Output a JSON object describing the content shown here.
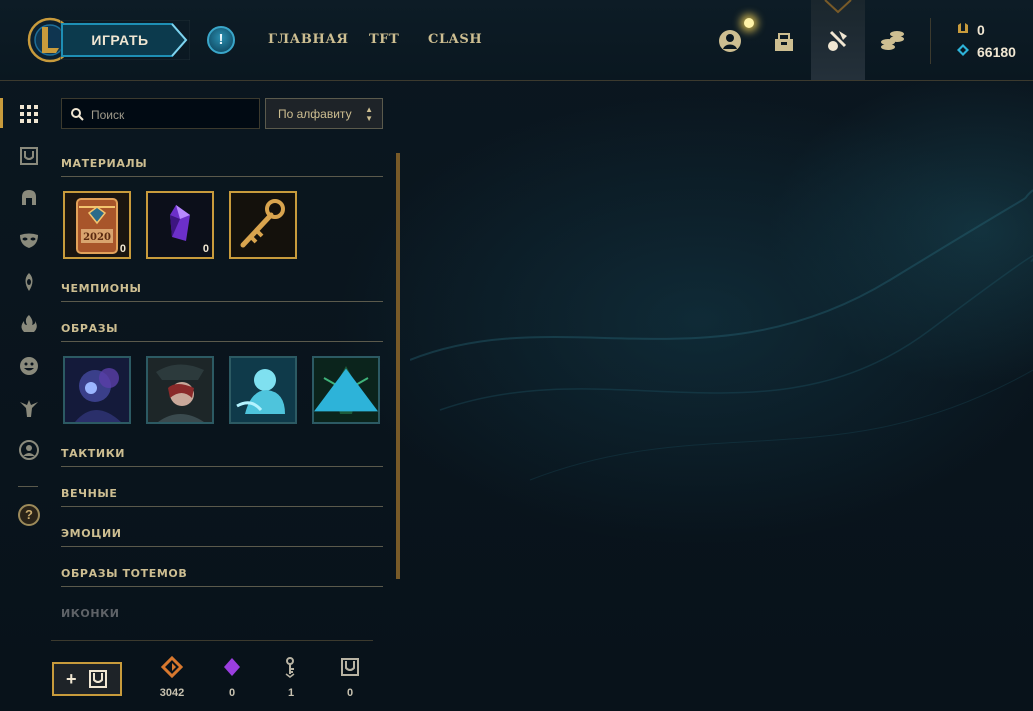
{
  "header": {
    "play_label": "ИГРАТЬ",
    "alert_glyph": "!",
    "nav": [
      "ГЛАВНАЯ",
      "TFT",
      "CLASH"
    ],
    "icons": [
      "profile-icon",
      "collection-icon",
      "loot-icon",
      "store-icon"
    ],
    "currency": {
      "rp": "0",
      "blue_essence": "66180"
    }
  },
  "rail": {
    "icons": [
      "grid-icon",
      "chest-icon",
      "helmet-icon",
      "mask-icon",
      "ward-icon",
      "flame-icon",
      "emote-icon",
      "totem-icon",
      "icon-icon"
    ],
    "help_glyph": "?"
  },
  "search": {
    "placeholder": "Поиск",
    "value": ""
  },
  "sort": {
    "label": "По алфавиту"
  },
  "categories": {
    "materials": "МАТЕРИАЛЫ",
    "champions": "ЧЕМПИОНЫ",
    "skins": "ОБРАЗЫ",
    "tactics": "ТАКТИКИ",
    "eternals": "ВЕЧНЫЕ",
    "emotes": "ЭМОЦИИ",
    "ward_skins": "ОБРАЗЫ ТОТЕМОВ",
    "icons": "ИКОНКИ"
  },
  "materials": [
    {
      "name": "2020-capsule",
      "year": "2020",
      "count": "0"
    },
    {
      "name": "gem",
      "count": "0"
    },
    {
      "name": "key-fragment",
      "count": ""
    }
  ],
  "skins": [
    "skin-shard-1",
    "skin-shard-2",
    "skin-shard-3",
    "skin-shard-4"
  ],
  "footer": {
    "add_label": "+",
    "essences": [
      {
        "icon": "orange-essence-icon",
        "value": "3042",
        "color": "#d8782e"
      },
      {
        "icon": "gem-icon",
        "value": "0",
        "color": "#9b3ee0"
      },
      {
        "icon": "key-icon",
        "value": "1",
        "color": "#b8b3a3"
      },
      {
        "icon": "chest-icon",
        "value": "0",
        "color": "#b8b3a3"
      }
    ]
  },
  "colors": {
    "gold": "#c89b3c",
    "text": "#cdbe91",
    "bg": "#0a141d"
  }
}
